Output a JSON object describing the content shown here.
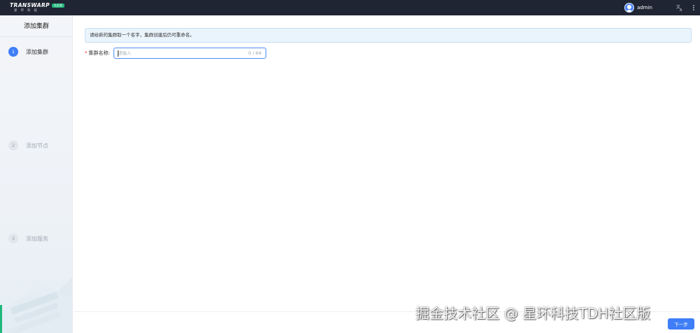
{
  "header": {
    "logo_text": "TRANSWARP",
    "logo_sub": "星环科技",
    "logo_badge": "社区版",
    "username": "admin",
    "lang_icon": "translate-icon",
    "more_icon": "more-vertical-icon"
  },
  "sidebar": {
    "title": "添加集群",
    "steps": [
      {
        "num": "1",
        "label": "添加集群",
        "state": "active"
      },
      {
        "num": "2",
        "label": "添加节点",
        "state": "inactive"
      },
      {
        "num": "3",
        "label": "添加服务",
        "state": "inactive"
      }
    ]
  },
  "main": {
    "alert_text": "请给新的集群取一个名字，集群创建后仍可重命名。",
    "form": {
      "required_mark": "*",
      "label": "集群名称:",
      "placeholder": "请输入",
      "value": "",
      "counter": "0 / 64"
    },
    "watermark": "掘金技术社区 @ 星环科技TDH社区版",
    "next_button": "下一步"
  },
  "colors": {
    "topbar": "#1f2533",
    "primary": "#3f7ef6",
    "accent_green": "#1fb77a"
  }
}
